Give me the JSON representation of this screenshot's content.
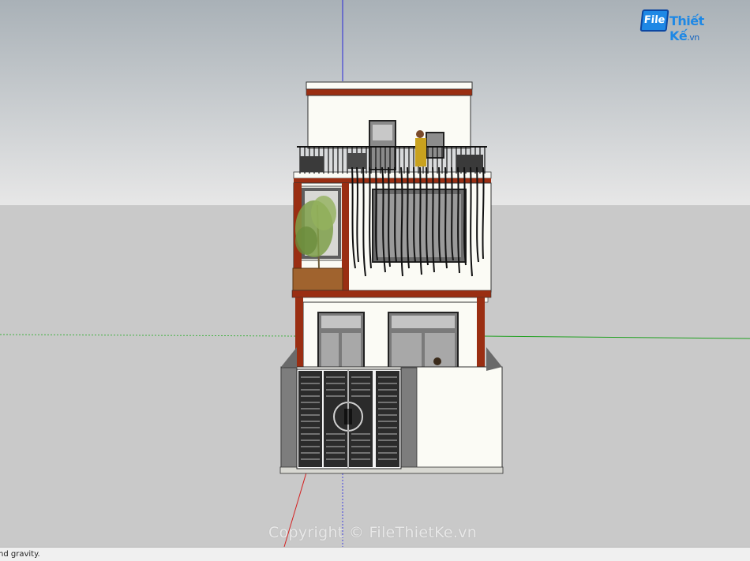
{
  "logo": {
    "word1": "File",
    "word2": "Thiết Kế",
    "suffix": ".vn"
  },
  "watermark": "Copyright © FileThietKe.vn",
  "statusbar": {
    "text": "nd gravity."
  },
  "colors": {
    "sky": "#dcdcdc",
    "ground": "#c9c9c9",
    "wall": "#fbfbf5",
    "beam": "#9a2e12",
    "frame": "#4a4a4a",
    "gate": "#2b2b2b",
    "axis_blue": "#2828d8",
    "axis_red": "#d42020",
    "axis_green": "#20a020"
  }
}
